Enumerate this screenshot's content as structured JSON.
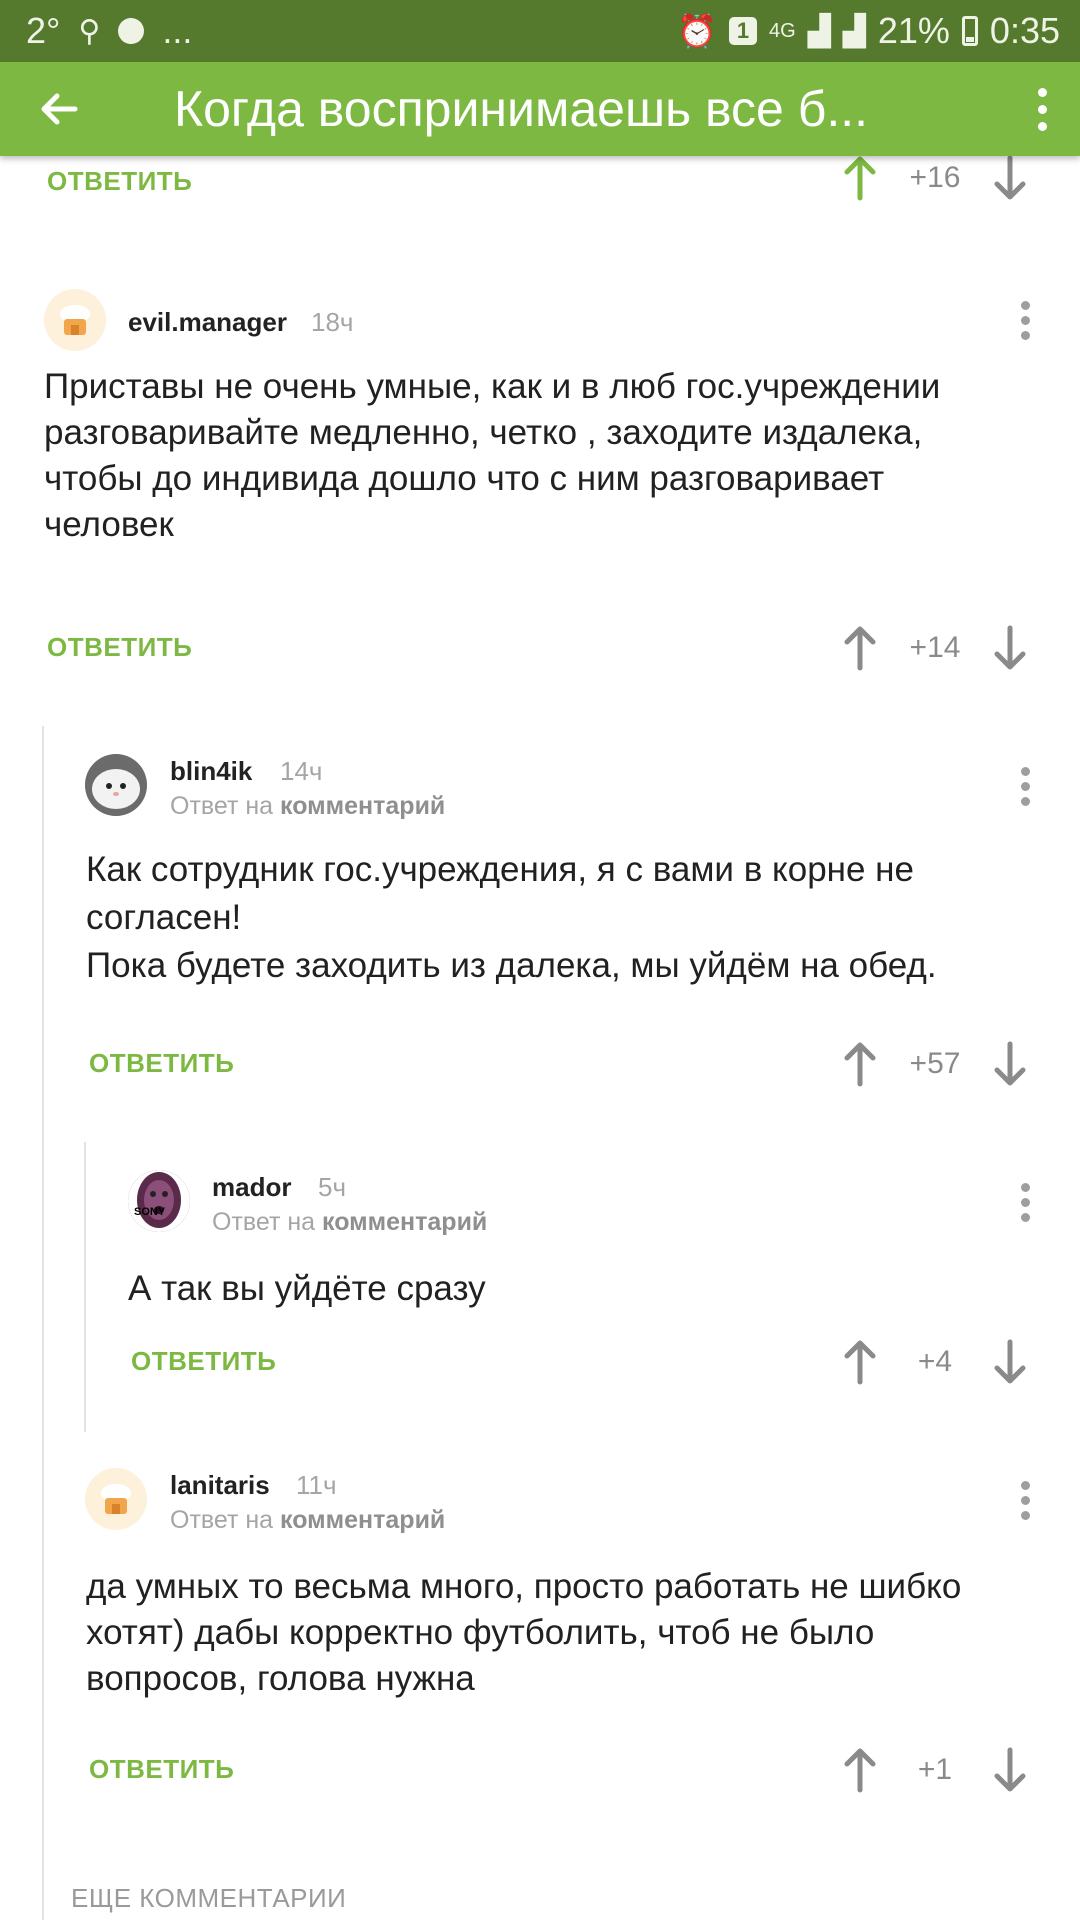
{
  "status_bar": {
    "temperature": "2°",
    "ellipsis": "...",
    "notification_count": "1",
    "network": "4G",
    "battery": "21%",
    "time": "0:35"
  },
  "app_bar": {
    "title": "Когда воспринимаешь все б..."
  },
  "reply_label": "ОТВЕТИТЬ",
  "reply_to_prefix": "Ответ на",
  "reply_to_target": "комментарий",
  "top_item": {
    "score": "+16"
  },
  "comments": [
    {
      "username": "evil.manager",
      "time": "18ч",
      "text_lines": [
        "Приставы не очень умные, как и в люб гос.учреждении",
        "разговаривайте медленно, четко , заходите издалека,",
        "чтобы до индивида дошло что с ним разговаривает",
        "человек"
      ],
      "score": "+14"
    },
    {
      "username": "blin4ik",
      "time": "14ч",
      "text_lines": [
        "Как сотрудник гос.учреждения, я с вами в корне не",
        "согласен!",
        "Пока будете заходить из далека, мы уйдём на обед."
      ],
      "score": "+57"
    },
    {
      "username": "mador",
      "time": "5ч",
      "avatar_text": "SONY",
      "text_lines": [
        "А так вы уйдёте сразу"
      ],
      "score": "+4"
    },
    {
      "username": "lanitaris",
      "time": "11ч",
      "text_lines": [
        "да умных то весьма много, просто работать не шибко",
        "хотят) дабы корректно футболить, чтоб не было",
        "вопросов, голова нужна"
      ],
      "score": "+1"
    }
  ],
  "more_comments": "ЕЩЕ КОММЕНТАРИИ",
  "colors": {
    "status_bar": "#567a2d",
    "app_bar": "#7db942",
    "accent_green": "#7db942",
    "muted": "#a5a5a5"
  }
}
